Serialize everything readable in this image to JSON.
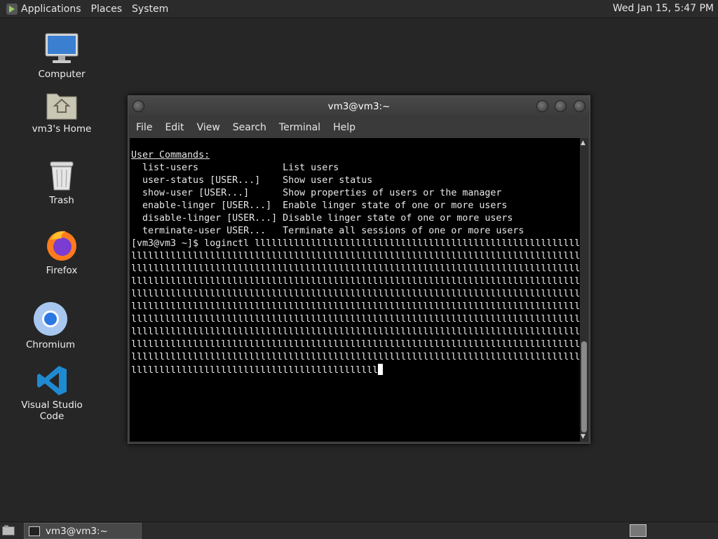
{
  "top_panel": {
    "menus": [
      "Applications",
      "Places",
      "System"
    ],
    "clock": "Wed Jan 15,  5:47 PM"
  },
  "desktop_icons": [
    {
      "label": "Computer",
      "icon": "computer-icon"
    },
    {
      "label": "vm3's Home",
      "icon": "home-folder-icon"
    },
    {
      "label": "Trash",
      "icon": "trash-icon"
    },
    {
      "label": "Firefox",
      "icon": "firefox-icon"
    },
    {
      "label": "Chromium",
      "icon": "chromium-icon"
    },
    {
      "label": "Visual Studio Code",
      "icon": "vscode-icon"
    }
  ],
  "terminal": {
    "title": "vm3@vm3:~",
    "menus": [
      "File",
      "Edit",
      "View",
      "Search",
      "Terminal",
      "Help"
    ],
    "section_header": "User Commands:",
    "commands": [
      {
        "cmd": "  list-users               ",
        "desc": "List users"
      },
      {
        "cmd": "  user-status [USER...]    ",
        "desc": "Show user status"
      },
      {
        "cmd": "  show-user [USER...]      ",
        "desc": "Show properties of users or the manager"
      },
      {
        "cmd": "  enable-linger [USER...]  ",
        "desc": "Enable linger state of one or more users"
      },
      {
        "cmd": "  disable-linger [USER...] ",
        "desc": "Disable linger state of one or more users"
      },
      {
        "cmd": "  terminate-user USER...   ",
        "desc": "Terminate all sessions of one or more users"
      }
    ],
    "prompt": "[vm3@vm3 ~]$ ",
    "input_text": "loginctl llllllllllllllllllllllllllllllllllllllllllllllllllllllllllllllllllllllllllllllllllllllllllllllllllllllllllllllllllllllllllllllllllllllllllllllllllllllllllllllllllllllllllllllllllllllllllllllllllllllllllllllllllllllllllllllllllllllllllllllllllllllllllllllllllllllllllllllllllllllllllllllllllllllllllllllllllllllllllllllllllllllllllllllllllllllllllllllllllllllllllllllllllllllllllllllllllllllllllllllllllllllllllllllllllllllllllllllllllllllllllllllllllllllllllllllllllllllllllllllllllllllllllllllllllllllllllllllllllllllllllllllllllllllllllllllllllllllllllllllllllllllllllllllllllllllllllllllllllllllllllllllllllllllllllllllllllllllllllllllllllllllllllllllllllllllllllllllllllllllllllllllllllllllllllllllllllllllllllllllllllllllllllllllllllllllllllllllllllllllllllllllllllllllllllllllllllllllllllllllllllllllllllllllllllllll",
    "wrap_columns": 80
  },
  "taskbar": {
    "task_label": "vm3@vm3:~"
  },
  "colors": {
    "desktop_bg": "#262626",
    "terminal_bg": "#000000",
    "terminal_fg": "#e8e8e8"
  }
}
